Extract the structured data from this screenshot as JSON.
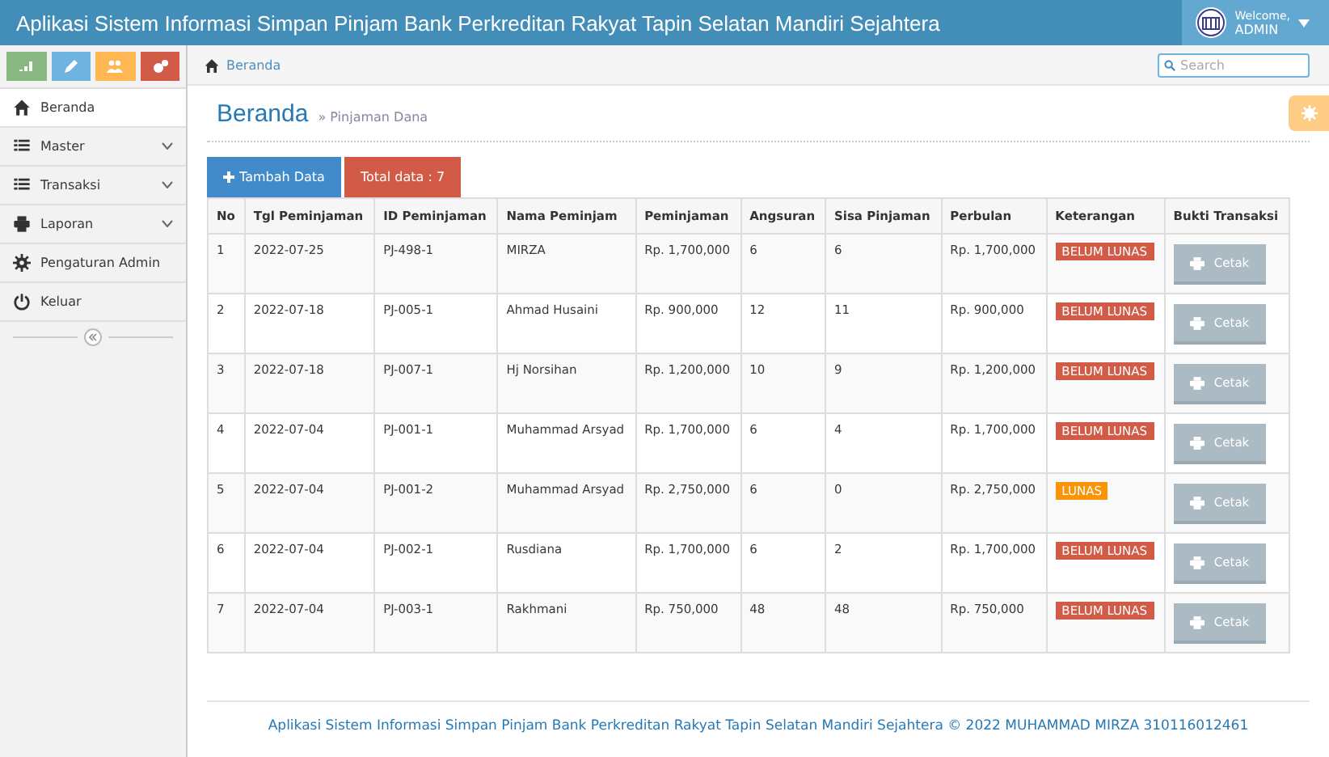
{
  "header": {
    "title": "Aplikasi Sistem Informasi Simpan Pinjam Bank Perkreditan Rakyat Tapin Selatan Mandiri Sejahtera",
    "welcome": "Welcome,",
    "user": "ADMIN"
  },
  "sidebar": {
    "items": [
      {
        "label": "Beranda",
        "selected": true,
        "submenu": false
      },
      {
        "label": "Master",
        "selected": false,
        "submenu": true
      },
      {
        "label": "Transaksi",
        "selected": false,
        "submenu": true
      },
      {
        "label": "Laporan",
        "selected": false,
        "submenu": true
      },
      {
        "label": "Pengaturan Admin",
        "selected": false,
        "submenu": false
      },
      {
        "label": "Keluar",
        "selected": false,
        "submenu": false
      }
    ]
  },
  "breadcrumb": {
    "label": "Beranda"
  },
  "search": {
    "placeholder": "Search"
  },
  "page": {
    "title": "Beranda",
    "subtitle": "» Pinjaman Dana"
  },
  "add_button": "Tambah Data",
  "total_badge": "Total data : 7",
  "table": {
    "columns": [
      "No",
      "Tgl Peminjaman",
      "ID Peminjaman",
      "Nama Peminjam",
      "Peminjaman",
      "Angsuran",
      "Sisa Pinjaman",
      "Perbulan",
      "Keterangan",
      "Bukti Transaksi"
    ],
    "rows": [
      {
        "cells": [
          "1",
          "2022-07-25",
          "PJ-498-1",
          "MIRZA",
          "Rp. 1,700,000",
          "6",
          "6",
          "Rp. 1,700,000"
        ],
        "status": "BELUM LUNAS",
        "kind": "unpaid",
        "action": "Cetak"
      },
      {
        "cells": [
          "2",
          "2022-07-18",
          "PJ-005-1",
          "Ahmad Husaini",
          "Rp. 900,000",
          "12",
          "11",
          "Rp. 900,000"
        ],
        "status": "BELUM LUNAS",
        "kind": "unpaid",
        "action": "Cetak"
      },
      {
        "cells": [
          "3",
          "2022-07-18",
          "PJ-007-1",
          "Hj Norsihan",
          "Rp. 1,200,000",
          "10",
          "9",
          "Rp. 1,200,000"
        ],
        "status": "BELUM LUNAS",
        "kind": "unpaid",
        "action": "Cetak"
      },
      {
        "cells": [
          "4",
          "2022-07-04",
          "PJ-001-1",
          "Muhammad Arsyad",
          "Rp. 1,700,000",
          "6",
          "4",
          "Rp. 1,700,000"
        ],
        "status": "BELUM LUNAS",
        "kind": "unpaid",
        "action": "Cetak"
      },
      {
        "cells": [
          "5",
          "2022-07-04",
          "PJ-001-2",
          "Muhammad Arsyad",
          "Rp. 2,750,000",
          "6",
          "0",
          "Rp. 2,750,000"
        ],
        "status": "LUNAS",
        "kind": "paid",
        "action": "Cetak"
      },
      {
        "cells": [
          "6",
          "2022-07-04",
          "PJ-002-1",
          "Rusdiana",
          "Rp. 1,700,000",
          "6",
          "2",
          "Rp. 1,700,000"
        ],
        "status": "BELUM LUNAS",
        "kind": "unpaid",
        "action": "Cetak"
      },
      {
        "cells": [
          "7",
          "2022-07-04",
          "PJ-003-1",
          "Rakhmani",
          "Rp. 750,000",
          "48",
          "48",
          "Rp. 750,000"
        ],
        "status": "BELUM LUNAS",
        "kind": "unpaid",
        "action": "Cetak"
      }
    ]
  },
  "footer": "Aplikasi Sistem Informasi Simpan Pinjam Bank Perkreditan Rakyat Tapin Selatan Mandiri Sejahtera © 2022 MUHAMMAD MIRZA 310116012461"
}
